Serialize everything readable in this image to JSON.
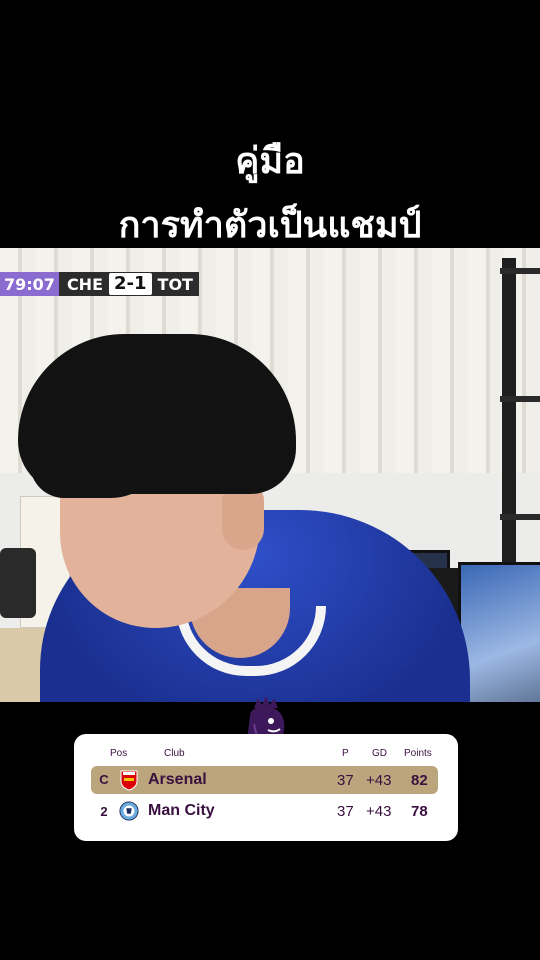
{
  "headline": {
    "line1": "คู่มือ",
    "line2": "การทำตัวเป็นแชมป์"
  },
  "scoreboard": {
    "clock": "79:07",
    "home_team": "CHE",
    "score": "2-1",
    "away_team": "TOT"
  },
  "league_table": {
    "logo_icon": "premier-league-lion-icon",
    "columns": [
      "Pos",
      "Club",
      "P",
      "GD",
      "Points"
    ],
    "rows": [
      {
        "pos": "C",
        "club": "Arsenal",
        "badge_icon": "arsenal-crest-icon",
        "p": "37",
        "gd": "+43",
        "points": "82",
        "highlight": true
      },
      {
        "pos": "2",
        "club": "Man City",
        "badge_icon": "man-city-crest-icon",
        "p": "37",
        "gd": "+43",
        "points": "78",
        "highlight": false
      }
    ],
    "colors": {
      "text": "#3a1040",
      "highlight_row": "#bba57c",
      "card": "#ffffff"
    }
  }
}
